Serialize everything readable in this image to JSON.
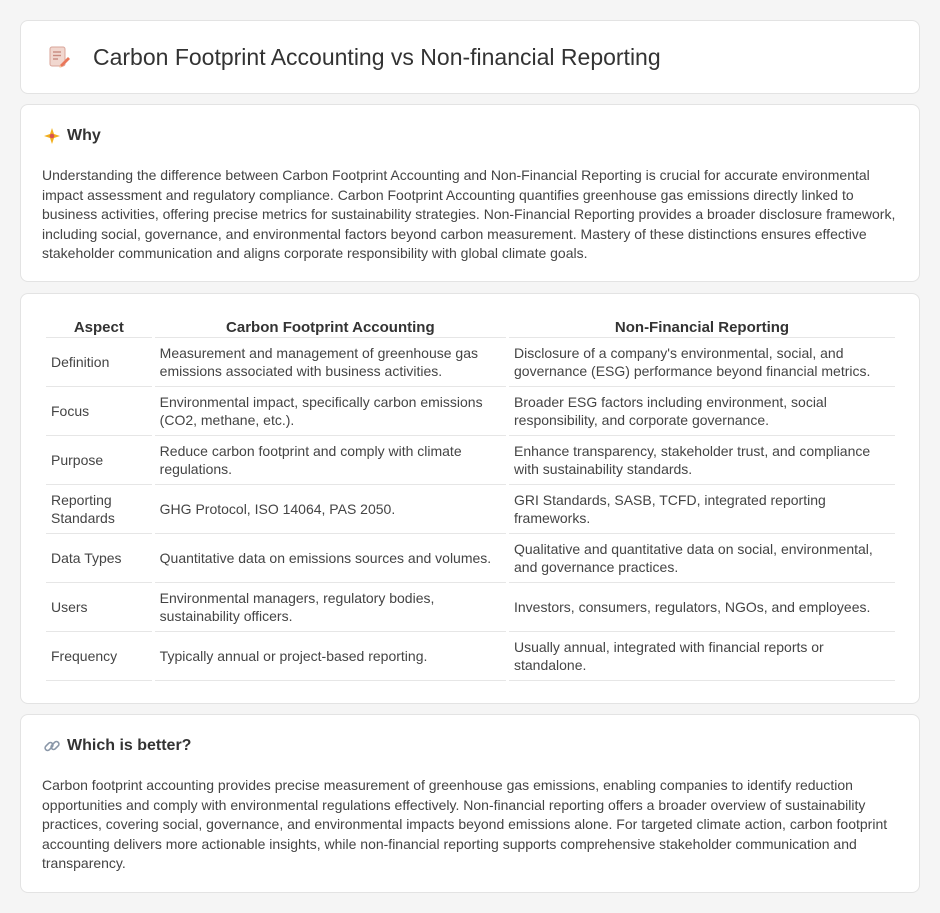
{
  "header": {
    "title": "Carbon Footprint Accounting vs Non-financial Reporting",
    "icon": "document-pencil-icon"
  },
  "why": {
    "icon": "sparkle-icon",
    "title": "Why",
    "body": "Understanding the difference between Carbon Footprint Accounting and Non-Financial Reporting is crucial for accurate environmental impact assessment and regulatory compliance. Carbon Footprint Accounting quantifies greenhouse gas emissions directly linked to business activities, offering precise metrics for sustainability strategies. Non-Financial Reporting provides a broader disclosure framework, including social, governance, and environmental factors beyond carbon measurement. Mastery of these distinctions ensures effective stakeholder communication and aligns corporate responsibility with global climate goals."
  },
  "table": {
    "headers": [
      "Aspect",
      "Carbon Footprint Accounting",
      "Non-Financial Reporting"
    ],
    "rows": [
      [
        "Definition",
        "Measurement and management of greenhouse gas emissions associated with business activities.",
        "Disclosure of a company's environmental, social, and governance (ESG) performance beyond financial metrics."
      ],
      [
        "Focus",
        "Environmental impact, specifically carbon emissions (CO2, methane, etc.).",
        "Broader ESG factors including environment, social responsibility, and corporate governance."
      ],
      [
        "Purpose",
        "Reduce carbon footprint and comply with climate regulations.",
        "Enhance transparency, stakeholder trust, and compliance with sustainability standards."
      ],
      [
        "Reporting Standards",
        "GHG Protocol, ISO 14064, PAS 2050.",
        "GRI Standards, SASB, TCFD, integrated reporting frameworks."
      ],
      [
        "Data Types",
        "Quantitative data on emissions sources and volumes.",
        "Qualitative and quantitative data on social, environmental, and governance practices."
      ],
      [
        "Users",
        "Environmental managers, regulatory bodies, sustainability officers.",
        "Investors, consumers, regulators, NGOs, and employees."
      ],
      [
        "Frequency",
        "Typically annual or project-based reporting.",
        "Usually annual, integrated with financial reports or standalone."
      ]
    ]
  },
  "better": {
    "icon": "link-icon",
    "title": "Which is better?",
    "body": "Carbon footprint accounting provides precise measurement of greenhouse gas emissions, enabling companies to identify reduction opportunities and comply with environmental regulations effectively. Non-financial reporting offers a broader overview of sustainability practices, covering social, governance, and environmental impacts beyond emissions alone. For targeted climate action, carbon footprint accounting delivers more actionable insights, while non-financial reporting supports comprehensive stakeholder communication and transparency."
  }
}
